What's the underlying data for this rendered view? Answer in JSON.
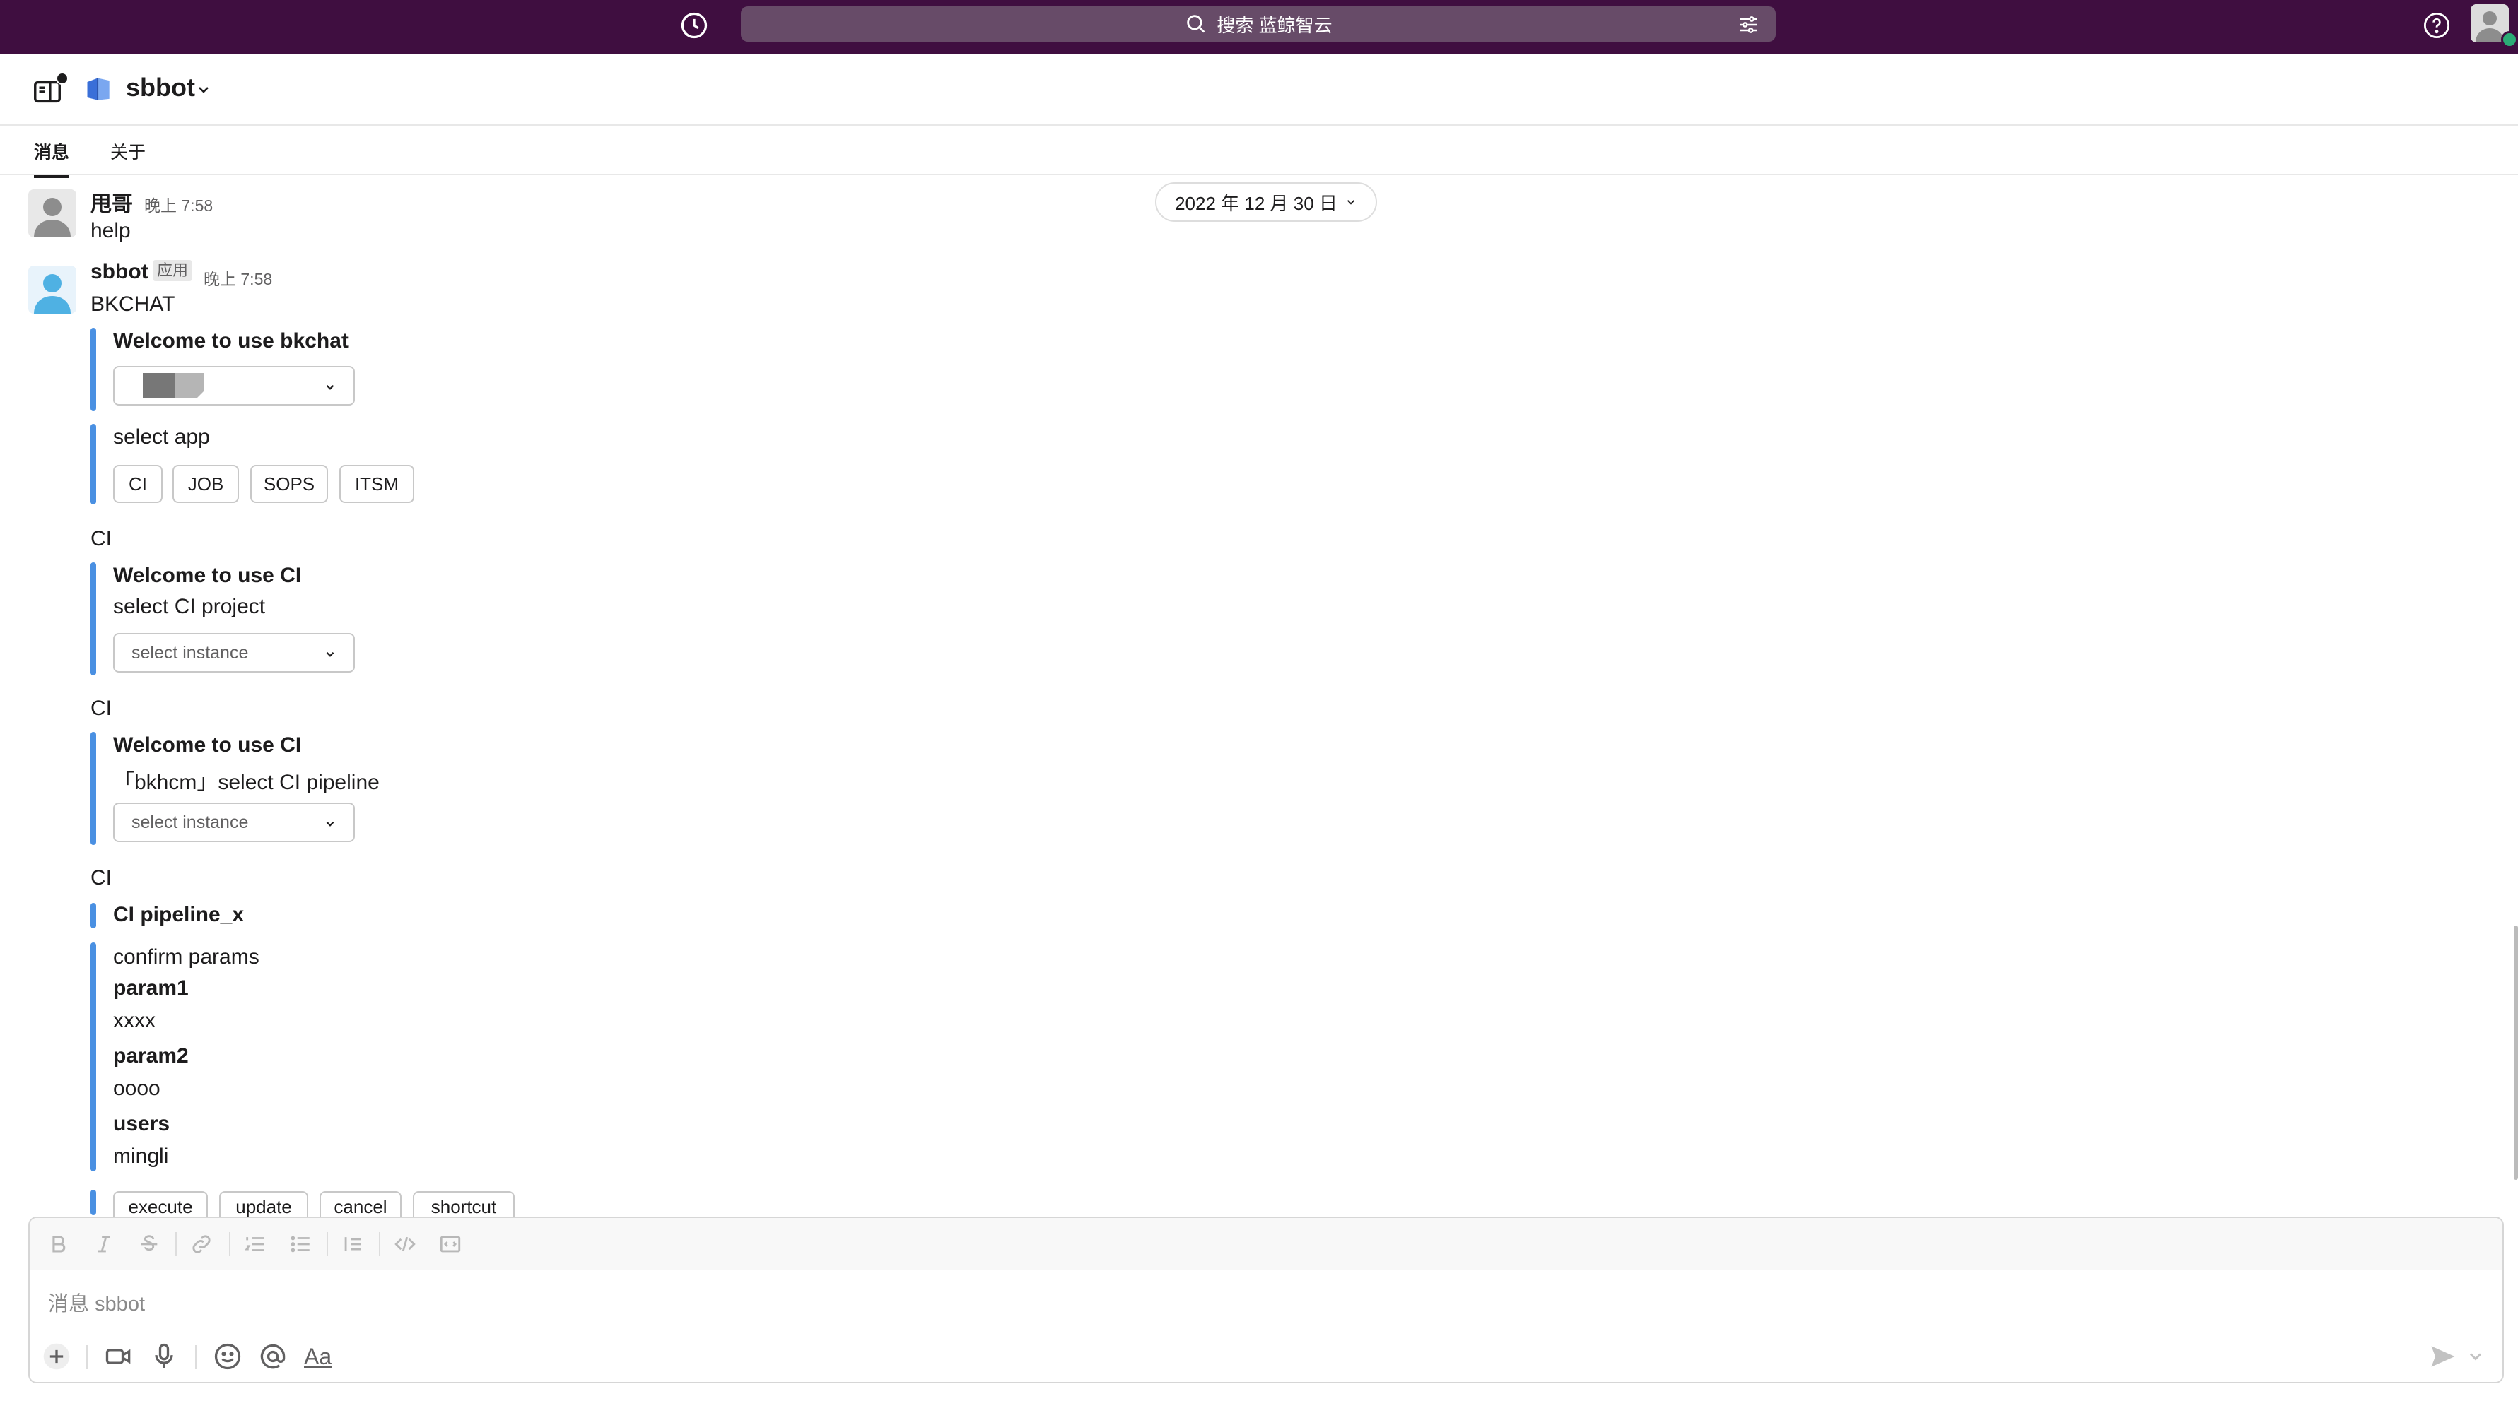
{
  "search": {
    "placeholder": "搜索 蓝鲸智云"
  },
  "channel": {
    "name": "sbbot"
  },
  "tabs": [
    {
      "label": "消息"
    },
    {
      "label": "关于"
    }
  ],
  "date_divider": "2022 年 12 月 30 日",
  "messages": {
    "user": {
      "name": "甩哥",
      "time": "晚上 7:58",
      "text": "help"
    },
    "bot": {
      "name": "sbbot",
      "badge": "应用",
      "time": "晚上 7:58",
      "title": "BKCHAT",
      "welcome": "Welcome to use bkchat",
      "select_app_label": "select app",
      "app_buttons": [
        "CI",
        "JOB",
        "SOPS",
        "ITSM"
      ],
      "ci_blocks": [
        {
          "header": "CI",
          "title": "Welcome to use CI",
          "subtitle": "select CI project",
          "select_placeholder": "select instance"
        },
        {
          "header": "CI",
          "title": "Welcome to use CI",
          "subtitle": "「bkhcm」select CI pipeline",
          "select_placeholder": "select instance"
        }
      ],
      "confirm": {
        "header": "CI",
        "pipeline": "CI pipeline_x",
        "label": "confirm params",
        "params": [
          {
            "key": "param1",
            "value": "xxxx"
          },
          {
            "key": "param2",
            "value": "oooo"
          },
          {
            "key": "users",
            "value": "mingli"
          }
        ],
        "actions": [
          "execute",
          "update",
          "cancel",
          "shortcut"
        ]
      }
    }
  },
  "composer": {
    "placeholder": "消息 sbbot",
    "format_label": "Aa"
  },
  "colors": {
    "topbar": "#3f0e40",
    "accent_bar": "#4a90e2",
    "online": "#2bac76"
  }
}
